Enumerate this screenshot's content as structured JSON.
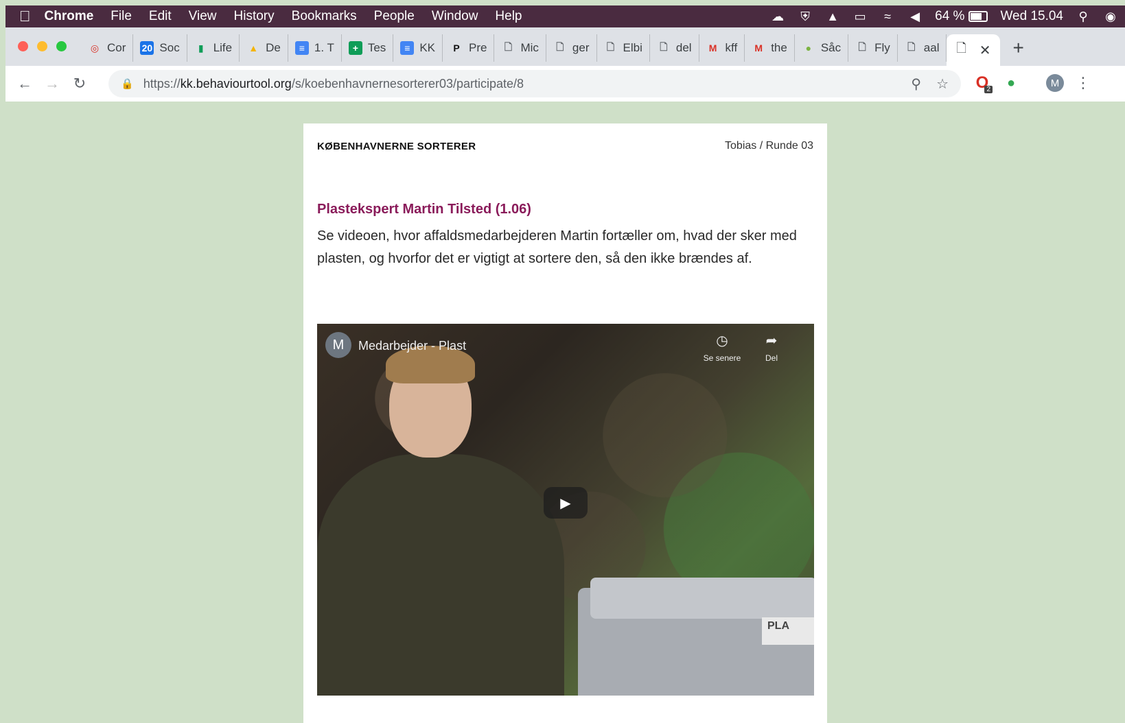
{
  "menubar": {
    "app": "Chrome",
    "items": [
      "File",
      "Edit",
      "View",
      "History",
      "Bookmarks",
      "People",
      "Window",
      "Help"
    ],
    "battery_percent": 64,
    "battery_label": "64 %",
    "clock": "Wed 15.04"
  },
  "tabs": [
    {
      "label": "Cor",
      "icon": "target-icon",
      "color": "#d93025"
    },
    {
      "label": "Soc",
      "icon": "calendar-icon",
      "color": "#1a73e8"
    },
    {
      "label": "Life",
      "icon": "bars-icon",
      "color": "#0f9d58"
    },
    {
      "label": "De",
      "icon": "drive-icon",
      "color": "#f4b400"
    },
    {
      "label": "1. T",
      "icon": "doc-icon",
      "color": "#4285f4"
    },
    {
      "label": "Tes",
      "icon": "sheet-icon",
      "color": "#0f9d58"
    },
    {
      "label": "KK",
      "icon": "doc-icon",
      "color": "#4285f4"
    },
    {
      "label": "Pre",
      "icon": "p-icon",
      "color": "#111111"
    },
    {
      "label": "Mic",
      "icon": "page-icon",
      "color": "#5f6368"
    },
    {
      "label": "ger",
      "icon": "page-icon",
      "color": "#5f6368"
    },
    {
      "label": "Elbi",
      "icon": "page-icon",
      "color": "#5f6368"
    },
    {
      "label": "del",
      "icon": "page-icon",
      "color": "#5f6368"
    },
    {
      "label": "kff",
      "icon": "gmail-icon",
      "color": "#d93025"
    },
    {
      "label": "the",
      "icon": "gmail-icon",
      "color": "#d93025"
    },
    {
      "label": "Såc",
      "icon": "circle-icon",
      "color": "#7cb342"
    },
    {
      "label": "Fly",
      "icon": "page-icon",
      "color": "#5f6368"
    },
    {
      "label": "aal",
      "icon": "page-icon",
      "color": "#5f6368"
    }
  ],
  "address": {
    "scheme": "https://",
    "host": "kk.behaviourtool.org",
    "path": "/s/koebenhavnernesorterer03/participate/8"
  },
  "extension_badge": "2",
  "profile_initial": "M",
  "page": {
    "brand": "KØBENHAVNERNE SORTERER",
    "participant": "Tobias / Runde 03",
    "title": "Plastekspert Martin Tilsted (1.06)",
    "body": "Se videoen, hvor affaldsmedarbejderen Martin fortæller om, hvad der sker med plasten, og hvorfor det er vigtigt at sortere den, så den ikke brændes af."
  },
  "video": {
    "channel_initial": "M",
    "title": "Medarbejder - Plast",
    "watch_later": "Se senere",
    "share": "Del",
    "bin_label": "PLA"
  }
}
